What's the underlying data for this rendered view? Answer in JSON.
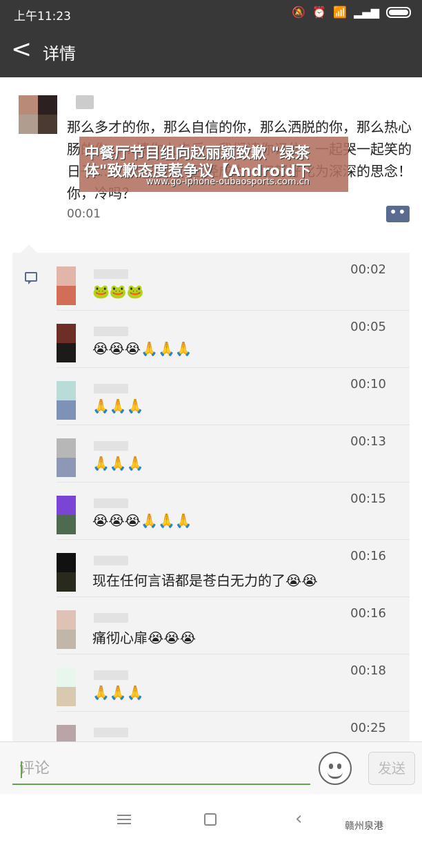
{
  "statusbar": {
    "time": "上午11:23",
    "icons": [
      "bell-off-icon",
      "alarm-icon",
      "wifi-icon",
      "signal-icon",
      "signal-icon",
      "battery-icon"
    ]
  },
  "navbar": {
    "back_glyph": "<",
    "title": "详情"
  },
  "post": {
    "text": "那么多才的你，那么自信的你，那么洒脱的你，那么热心肠的你……请你上去后，我们请你记住，一起哭一起笑的日子……你的离开，已经成为一切都好化为深深的思念！你，冷吗？",
    "time": "00:01"
  },
  "banner": {
    "line1": "中餐厅节目组向赵丽颖致歉 \"绿茶",
    "line2": "体\"致歉态度惹争议【Android下",
    "url": "www.go-iphone-oubaosports.com.cn"
  },
  "comments": [
    {
      "time": "00:02",
      "text": "🐸🐸🐸",
      "avatar": [
        "#e2b5a8",
        "#d26d58"
      ]
    },
    {
      "time": "00:05",
      "text": "😭😭😭🙏🙏🙏",
      "avatar": [
        "#6e2e28",
        "#1d1a1a"
      ]
    },
    {
      "time": "00:10",
      "text": "🙏🙏🙏",
      "avatar": [
        "#b9dcd9",
        "#7e92b8"
      ]
    },
    {
      "time": "00:13",
      "text": "🙏🙏🙏",
      "avatar": [
        "#b7b7b7",
        "#8d97b6"
      ]
    },
    {
      "time": "00:15",
      "text": "😭😭😭🙏🙏🙏",
      "avatar": [
        "#7a44d4",
        "#4e6a4f"
      ]
    },
    {
      "time": "00:16",
      "text": "现在任何言语都是苍白无力的了😭😭",
      "avatar": [
        "#111111",
        "#2a2a1c"
      ]
    },
    {
      "time": "00:16",
      "text": "痛彻心扉😭😭😭",
      "avatar": [
        "#e0c1b6",
        "#c2b6a8"
      ]
    },
    {
      "time": "00:18",
      "text": "🙏🙏🙏",
      "avatar": [
        "#e8f7ee",
        "#d9c9b0"
      ]
    },
    {
      "time": "00:25",
      "text": "",
      "avatar": [
        "#b9a4a6",
        "#c8b7b8"
      ]
    }
  ],
  "input": {
    "placeholder": "评论",
    "send_label": "发送"
  },
  "watermark": "赣州泉港"
}
